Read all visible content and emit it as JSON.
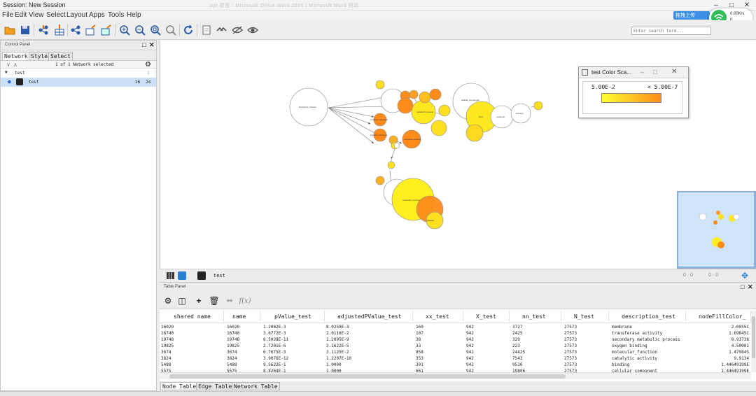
{
  "window": {
    "title": "Session: New Session",
    "ghost_text": "ppt 模板 - Microsoft Office Word 2016 | Microsoft Word 网站 ..."
  },
  "menu": [
    "File",
    "Edit",
    "View",
    "Select",
    "Layout",
    "Apps",
    "Tools",
    "Help"
  ],
  "toolbar": {
    "search_placeholder": "Enter search term..."
  },
  "overlay": {
    "upload_label": "拖拽上传",
    "speed_up": "0.00K/s",
    "speed_down": "0"
  },
  "control_panel": {
    "title": "Control Panel",
    "tabs": [
      "Network",
      "Style",
      "Select"
    ],
    "status": "1 of 1 Network selected",
    "collection": {
      "name": "test",
      "count": "1"
    },
    "network": {
      "name": "test",
      "nodes": "26",
      "edges": "24"
    }
  },
  "canvas": {
    "network_name": "test",
    "sel_nodes": "0 · 0",
    "sel_edges": "0 · 0"
  },
  "legend": {
    "title": "test Color Sca...",
    "low": "5.00E-2",
    "high": "< 5.00E-7",
    "color_low": "#ffff33",
    "color_high": "#ff8c1a"
  },
  "table_panel": {
    "title": "Table Panel",
    "columns": [
      "shared name",
      "name",
      "pValue_test",
      "adjustedPValue_test",
      "xx_test",
      "X_test",
      "nn_test",
      "N_test",
      "description_test",
      "nodeFillColor_"
    ],
    "rows": [
      [
        "16020",
        "16020",
        "1.2082E-3",
        "8.0259E-3",
        "160",
        "942",
        "3727",
        "27573",
        "membrane",
        "2.0955C"
      ],
      [
        "16740",
        "16740",
        "3.6772E-3",
        "2.0116E-2",
        "107",
        "942",
        "2425",
        "27573",
        "transferase activity",
        "1.69845C"
      ],
      [
        "19748",
        "19748",
        "6.5028E-11",
        "1.2095E-9",
        "38",
        "942",
        "329",
        "27573",
        "secondary metabolic process",
        "8.91738"
      ],
      [
        "19825",
        "19825",
        "2.7201E-6",
        "3.1622E-5",
        "33",
        "942",
        "223",
        "27573",
        "oxygen binding",
        "4.50001"
      ],
      [
        "3674",
        "3674",
        "6.7675E-3",
        "3.1125E-2",
        "858",
        "942",
        "24425",
        "27573",
        "molecular_function",
        "1.47984S"
      ],
      [
        "3824",
        "3824",
        "3.9076E-12",
        "1.2207E-10",
        "353",
        "942",
        "7543",
        "27573",
        "catalytic activity",
        "9.9134"
      ],
      [
        "5488",
        "5488",
        "9.5622E-1",
        "1.0000",
        "301",
        "942",
        "9510",
        "27573",
        "binding",
        "1.44649199E"
      ],
      [
        "5575",
        "5575",
        "8.8264E-1",
        "1.0000",
        "661",
        "942",
        "19806",
        "27573",
        "cellular_component",
        "1.44649199E"
      ]
    ],
    "bottom_tabs": [
      "Node Table",
      "Edge Table",
      "Network Table"
    ]
  }
}
